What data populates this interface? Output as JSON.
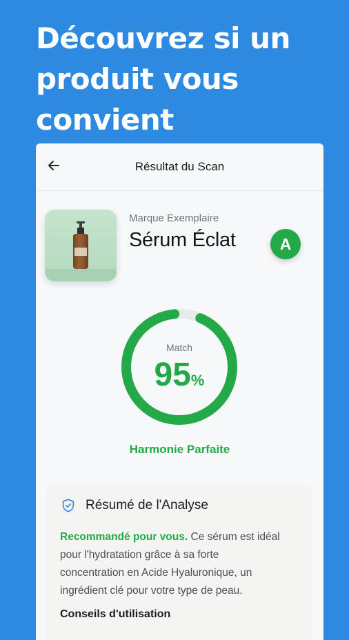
{
  "headline": {
    "line1": "Découvrez si un",
    "line2": "produit vous",
    "line3": "convient"
  },
  "appbar": {
    "back_icon": "arrow-left-icon",
    "title": "Résultat du Scan"
  },
  "product": {
    "brand": "Marque Exemplaire",
    "name": "Sérum Éclat",
    "grade": "A",
    "image": "serum-bottle"
  },
  "match": {
    "label": "Match",
    "value": "95",
    "unit": "%",
    "fraction": 0.95,
    "verdict": "Harmonie Parfaite"
  },
  "summary": {
    "icon": "shield-check-icon",
    "title": "Résumé de l'Analyse",
    "highlight": "Recommandé pour vous.",
    "text": " Ce sérum est idéal pour l'hydratation grâce à sa forte concentration en Acide Hyaluronique, un ingrédient clé pour votre type de peau.",
    "next_heading": "Conseils d'utilisation"
  },
  "colors": {
    "background": "#2d8ae0",
    "accent_green": "#23a947",
    "track": "#e8ebe9"
  }
}
